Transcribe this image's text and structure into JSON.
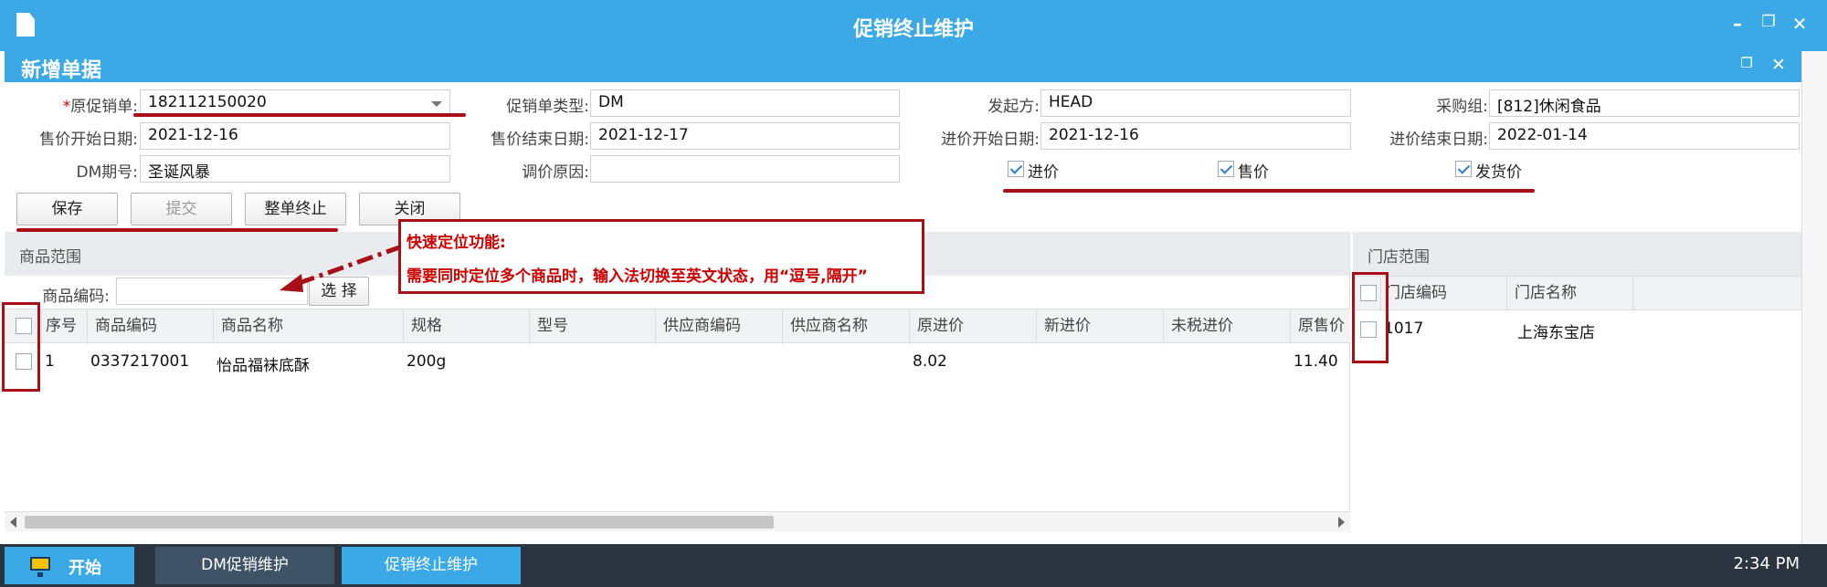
{
  "window": {
    "title": "促销终止维护"
  },
  "dialog": {
    "title": "新增单据"
  },
  "form": {
    "orig_promo_label": "原促销单:",
    "orig_promo_required": "*",
    "orig_promo_value": "182112150020",
    "promo_type_label": "促销单类型:",
    "promo_type_value": "DM",
    "initiator_label": "发起方:",
    "initiator_value": "HEAD",
    "purchase_group_label": "采购组:",
    "purchase_group_value": "[812]休闲食品",
    "sale_start_label": "售价开始日期:",
    "sale_start_value": "2021-12-16",
    "sale_end_label": "售价结束日期:",
    "sale_end_value": "2021-12-17",
    "cost_start_label": "进价开始日期:",
    "cost_start_value": "2021-12-16",
    "cost_end_label": "进价结束日期:",
    "cost_end_value": "2022-01-14",
    "dm_period_label": "DM期号:",
    "dm_period_value": "圣诞风暴",
    "adjust_reason_label": "调价原因:",
    "adjust_reason_value": "",
    "checkboxes": [
      {
        "label": "进价",
        "checked": true
      },
      {
        "label": "售价",
        "checked": true
      },
      {
        "label": "发货价",
        "checked": true
      }
    ]
  },
  "buttons": {
    "save": "保存",
    "submit": "提交",
    "terminate_all": "整单终止",
    "close": "关闭"
  },
  "goods_panel": {
    "title": "商品范围",
    "code_label": "商品编码:",
    "code_value": "",
    "select_button": "选 择",
    "columns": [
      "序号",
      "商品编码",
      "商品名称",
      "规格",
      "型号",
      "供应商编码",
      "供应商名称",
      "原进价",
      "新进价",
      "未税进价",
      "原售价"
    ],
    "rows": [
      {
        "seq": "1",
        "code": "0337217001",
        "name": "怡品福袜底酥",
        "spec": "200g",
        "model": "",
        "supplier_code": "",
        "supplier_name": "",
        "orig_cost": "8.02",
        "new_cost": "",
        "net_cost": "",
        "orig_price": "11.40"
      }
    ]
  },
  "store_panel": {
    "title": "门店范围",
    "columns": [
      "门店编码",
      "门店名称"
    ],
    "rows": [
      {
        "code": "1017",
        "name": "上海东宝店"
      }
    ]
  },
  "callout": {
    "line1": "快速定位功能:",
    "line2": "需要同时定位多个商品时，输入法切换至英文状态，用“逗号,隔开”"
  },
  "taskbar": {
    "start": "开始",
    "tasks": [
      "DM促销维护",
      "促销终止维护"
    ],
    "clock": "2:34 PM"
  },
  "colors": {
    "accent": "#3aa9e5",
    "annotation_red": "#a80f17",
    "taskbar": "#2b3540"
  }
}
